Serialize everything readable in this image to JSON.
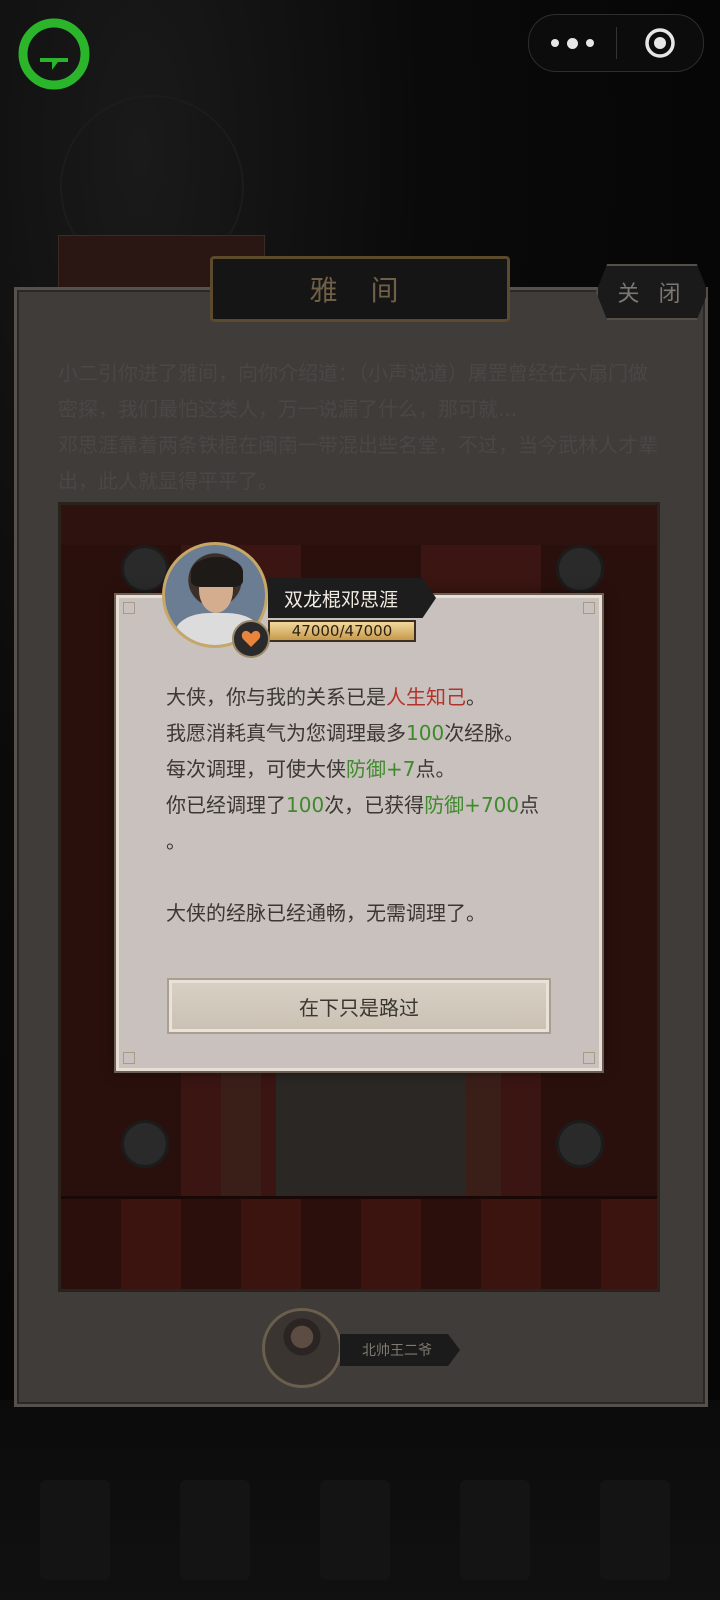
{
  "topbar": {
    "logo_icon": "chat-bubble-logo-icon",
    "more_icon": "more-dots-icon",
    "close_icon": "target-close-icon",
    "logo_color": "#2bb52b"
  },
  "panel": {
    "title": "雅 间",
    "close_label": "关 闭",
    "intro_lines": [
      "小二引你进了雅间，向你介绍道：（小声说道）屠罡曾经在六扇门做密探，我们最怕这类人，万一说漏了什么，那可就...",
      "邓思涯靠着两条铁棍在闽南一带混出些名堂，不过，当今武林人才辈出，此人就显得平平了。"
    ]
  },
  "npc": {
    "name": "双龙棍邓思涯",
    "hp": "47000/47000",
    "badge_icon": "heart-icon",
    "portrait": "npc-portrait"
  },
  "dialog": {
    "line1_a": "大侠，你与我的关系已是",
    "line1_red": "人生知己",
    "line1_b": "。",
    "line2_a": "我愿消耗真气为您调理最多",
    "line2_green": "100",
    "line2_b": "次经脉。",
    "line3_a": "每次调理，可使大侠",
    "line3_green": "防御+7",
    "line3_b": "点。",
    "line4_a": "你已经调理了",
    "line4_green1": "100",
    "line4_b": "次，已获得",
    "line4_green2": "防御+700",
    "line4_c": "点",
    "line5": "。",
    "line6": "大侠的经脉已经通畅，无需调理了。",
    "button_label": "在下只是路过"
  },
  "npc2": {
    "name": "北帅王二爷"
  },
  "colors": {
    "red_text": "#b5322a",
    "green_text": "#3e8a2c",
    "hp_bar": "#e6c27a"
  }
}
